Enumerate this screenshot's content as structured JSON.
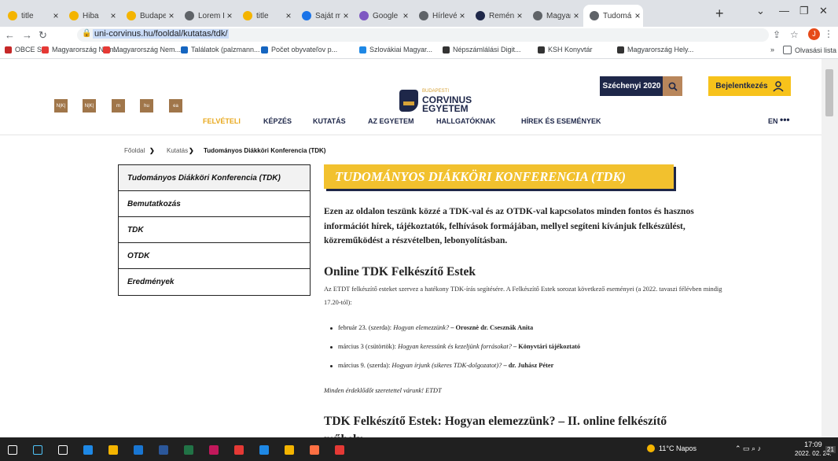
{
  "browser": {
    "tabs": [
      {
        "label": "title",
        "color": "#f4b400"
      },
      {
        "label": "Hiba",
        "color": "#f4b400"
      },
      {
        "label": "Budapest",
        "color": "#f4b400"
      },
      {
        "label": "Lorem Ip",
        "color": "#5f6368"
      },
      {
        "label": "title",
        "color": "#f4b400"
      },
      {
        "label": "Saját me",
        "color": "#1a73e8"
      },
      {
        "label": "Google F",
        "color": "#7e57c2"
      },
      {
        "label": "Hírlevél",
        "color": "#5f6368"
      },
      {
        "label": "Reménye",
        "color": "#1e2749"
      },
      {
        "label": "Magyar F",
        "color": "#5f6368"
      },
      {
        "label": "Tudomán",
        "color": "#5f6368"
      }
    ],
    "url": "uni-corvinus.hu/fooldal/kutatas/tdk/",
    "profile_initial": "J",
    "bookmarks": [
      {
        "label": "OBCE SR",
        "color": "#c62828"
      },
      {
        "label": "Magyarország Nem...",
        "color": "#e53935"
      },
      {
        "label": "Magyarország Nem...",
        "color": "#e53935"
      },
      {
        "label": "Találatok (palzmann...",
        "color": "#1565c0"
      },
      {
        "label": "Počet obyvateľov p...",
        "color": "#1565c0"
      },
      {
        "label": "Szlovákiai Magyar...",
        "color": "#1e88e5"
      },
      {
        "label": "Népszámlálási Digit...",
        "color": "#333333"
      },
      {
        "label": "KSH Konyvtár",
        "color": "#333333"
      },
      {
        "label": "Magyarország Hely...",
        "color": "#333333"
      }
    ],
    "reading_list": "Olvasási lista"
  },
  "header": {
    "social_icons": [
      "N|K|",
      "N|K|",
      "m",
      "hu",
      "ea"
    ],
    "logo": {
      "line1": "BUDAPESTI",
      "line2": "CORVINUS",
      "line3": "EGYETEM"
    },
    "szechenyi": "Széchenyi 2020",
    "login": "Bejelentkezés",
    "menu": [
      "FELVÉTELI",
      "KÉPZÉS",
      "KUTATÁS",
      "AZ EGYETEM",
      "HALLGATÓKNAK",
      "HÍREK ÉS ESEMÉNYEK"
    ],
    "lang": "EN"
  },
  "breadcrumb": [
    "Főoldal",
    "Kutatás",
    "Tudományos Diákköri Konferencia (TDK)"
  ],
  "sidebar": [
    "Tudományos Diákköri Konferencia (TDK)",
    "Bemutatkozás",
    "TDK",
    "OTDK",
    "Eredmények"
  ],
  "main": {
    "title": "TUDOMÁNYOS DIÁKKÖRI KONFERENCIA (TDK)",
    "intro": "Ezen az oldalon teszünk közzé a TDK-val és az OTDK-val kapcsolatos minden fontos és hasznos információt hírek, tájékoztatók, felhívások formájában, mellyel segíteni kívánjuk felkészülést, közreműködést a részvételben, lebonyolításban.",
    "section1_title": "Online TDK Felkészítő Estek",
    "section1_text": "Az ETDT felkészítő esteket szervez a hatékony TDK-írás segítésére. A Felkészítő Estek sorozat következő eseményei (a 2022. tavaszi félévben mindig 17.20-tól):",
    "events": [
      {
        "date": "február 23. (szerda): ",
        "topic": "Hogyan elemezzünk?",
        "presenter": " – Orosznè dr. Csesznák Anita"
      },
      {
        "date": "március 3 (csütörtök): ",
        "topic": "Hogyan keressünk és kezeljünk forrásokat?",
        "presenter": " – Könyvtári tájékoztató"
      },
      {
        "date": "március 9. (szerda): ",
        "topic": "Hogyan írjunk (sikeres TDK-dolgozatot)?",
        "presenter": " – dr. Juhász Péter"
      }
    ],
    "note": "Minden érdeklődőt szeretettel várunk! ETDT",
    "section2_title": "TDK Felkészítő Estek: Hogyan elemezzünk? – II. online felkészítő műhely"
  },
  "taskbar": {
    "weather": "11°C Napos",
    "time": "17:09",
    "date": "2022. 02. 24.",
    "notifications": "21"
  }
}
